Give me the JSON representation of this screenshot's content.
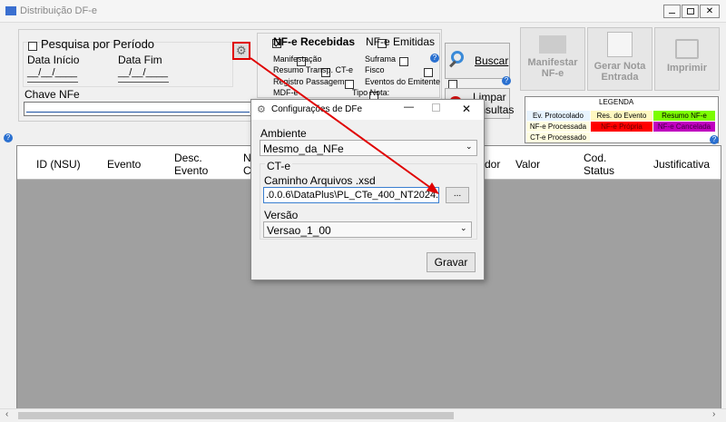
{
  "window": {
    "title": "Distribuição DF-e"
  },
  "period": {
    "checkbox_label": "Pesquisa por Período",
    "start_label": "Data Início",
    "end_label": "Data Fim",
    "start_value": "__/__/____",
    "end_value": "__/__/____"
  },
  "chave": {
    "label": "Chave NFe",
    "value": ""
  },
  "options": {
    "recebidas": "NF-e Recebidas",
    "emitidas": "NF-e Emitidas",
    "manifestacao": "Manifestação",
    "suframa": "Suframa",
    "resumo_transp": "Resumo Transp. CT-e",
    "fisco": "Fisco",
    "registro_passagem": "Registro Passagem",
    "eventos_emitente": "Eventos do Emitente",
    "mdfe": "MDF-e",
    "tipo_nota": "Tipo Nota:"
  },
  "buttons": {
    "buscar": "Buscar",
    "limpar": "Limpar",
    "limpar2": "Consultas",
    "manifestar": "Manifestar NF-e",
    "gerar_nota": "Gerar Nota Entrada",
    "imprimir": "Imprimir"
  },
  "legend": {
    "title": "LEGENDA",
    "items": [
      "Ev. Protocolado",
      "Res. do Evento",
      "Resumo NF-e",
      "NF-e Processada",
      "NF-e Própria",
      "NF-e Cancelada",
      "CT-e Processado"
    ]
  },
  "table": {
    "headers": [
      "ID (NSU)",
      "Evento",
      "Desc. Evento",
      "N C",
      "dor",
      "Valor",
      "Cod. Status",
      "Justificativa"
    ]
  },
  "dialog": {
    "title": "Configurações de DFe",
    "ambiente_label": "Ambiente",
    "ambiente_value": "Mesmo_da_NFe",
    "group_label": "CT-e",
    "caminho_label": "Caminho Arquivos .xsd",
    "caminho_value": ".0.0.6\\DataPlus\\PL_CTe_400_NT2024.002\\",
    "browse": "...",
    "versao_label": "Versão",
    "versao_value": "Versao_1_00",
    "gravar": "Gravar"
  },
  "colors": {
    "accent_red": "#e00000",
    "legend_green": "#7cfc00",
    "legend_red": "#ff0000",
    "legend_purple": "#c000c0",
    "grid_bg": "#a0a0a0"
  }
}
